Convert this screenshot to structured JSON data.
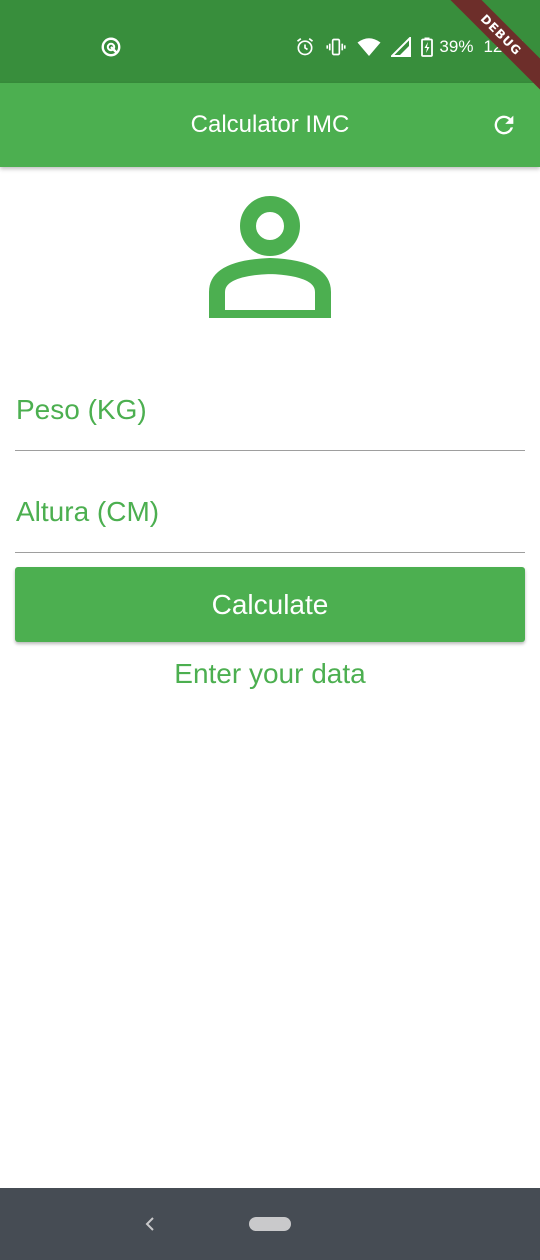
{
  "status_bar": {
    "battery_percent": "39%",
    "time": "12:41",
    "icons": [
      "sync-disabled-icon",
      "alarm-icon",
      "vibrate-icon",
      "wifi-icon",
      "signal-icon",
      "battery-charging-icon"
    ]
  },
  "debug_banner": {
    "label": "DEBUG"
  },
  "app_bar": {
    "title": "Calculator IMC",
    "refresh_icon": "refresh-icon"
  },
  "form": {
    "avatar_icon": "person-outline-icon",
    "weight": {
      "placeholder": "Peso (KG)",
      "value": ""
    },
    "height": {
      "placeholder": "Altura (CM)",
      "value": ""
    },
    "calculate_label": "Calculate",
    "info_text": "Enter your data"
  },
  "nav_bar": {
    "icons": [
      "back-icon",
      "home-pill-icon"
    ]
  },
  "colors": {
    "status_bar": "#388E3C",
    "primary": "#4CAF50",
    "nav_bar": "#464c54",
    "debug": "#6d2e2a"
  }
}
